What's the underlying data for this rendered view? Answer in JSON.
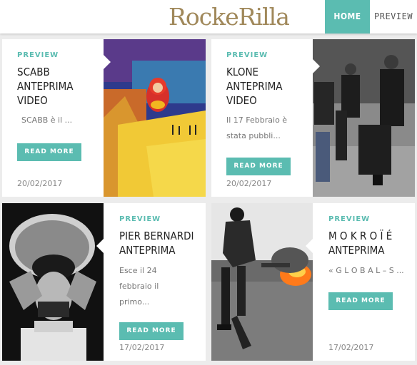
{
  "header": {
    "logo_text": "RockeRilla",
    "nav": {
      "home": "HOME",
      "preview": "PREVIEW"
    }
  },
  "colors": {
    "accent": "#5bbcb1",
    "logo": "#a0885a"
  },
  "cards": [
    {
      "category": "PREVIEW",
      "title": "SCABB ANTEPRIMA VIDEO",
      "excerpt": "SCABB è il ...",
      "button": "READ MORE",
      "date": "20/02/2017"
    },
    {
      "category": "PREVIEW",
      "title": "KLONE ANTEPRIMA VIDEO",
      "excerpt": "Il 17 Febbraio è stata pubbli...",
      "button": "READ MORE",
      "date": "20/02/2017"
    },
    {
      "category": "PREVIEW",
      "title": "PIER BERNARDI ANTEPRIMA",
      "excerpt": "Esce il 24 febbraio il primo...",
      "button": "READ MORE",
      "date": "17/02/2017"
    },
    {
      "category": "PREVIEW",
      "title": "M O K R O Ï É ANTEPRIMA",
      "excerpt": "« G L O B A L – S ...",
      "button": "READ MORE",
      "date": "17/02/2017"
    }
  ]
}
